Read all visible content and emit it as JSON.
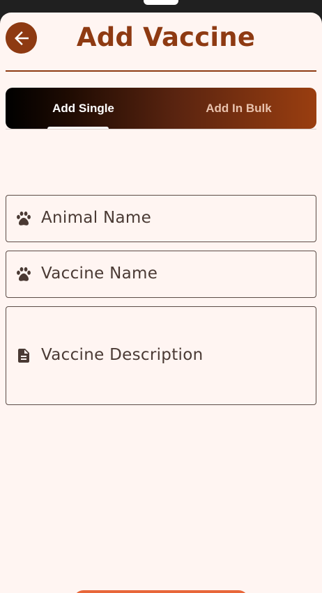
{
  "header": {
    "title": "Add Vaccine"
  },
  "tabs": [
    {
      "label": "Add Single",
      "selected": true
    },
    {
      "label": "Add In Bulk",
      "selected": false
    }
  ],
  "form": {
    "animal_name": {
      "placeholder": "Animal Name",
      "icon": "paw-icon"
    },
    "vaccine_name": {
      "placeholder": "Vaccine Name",
      "icon": "paw-icon"
    },
    "vaccine_description": {
      "placeholder": "Vaccine Description",
      "icon": "document-icon"
    }
  },
  "colors": {
    "brand": "#8e3a12",
    "background": "#fff5f2",
    "button": "#e8673a"
  }
}
